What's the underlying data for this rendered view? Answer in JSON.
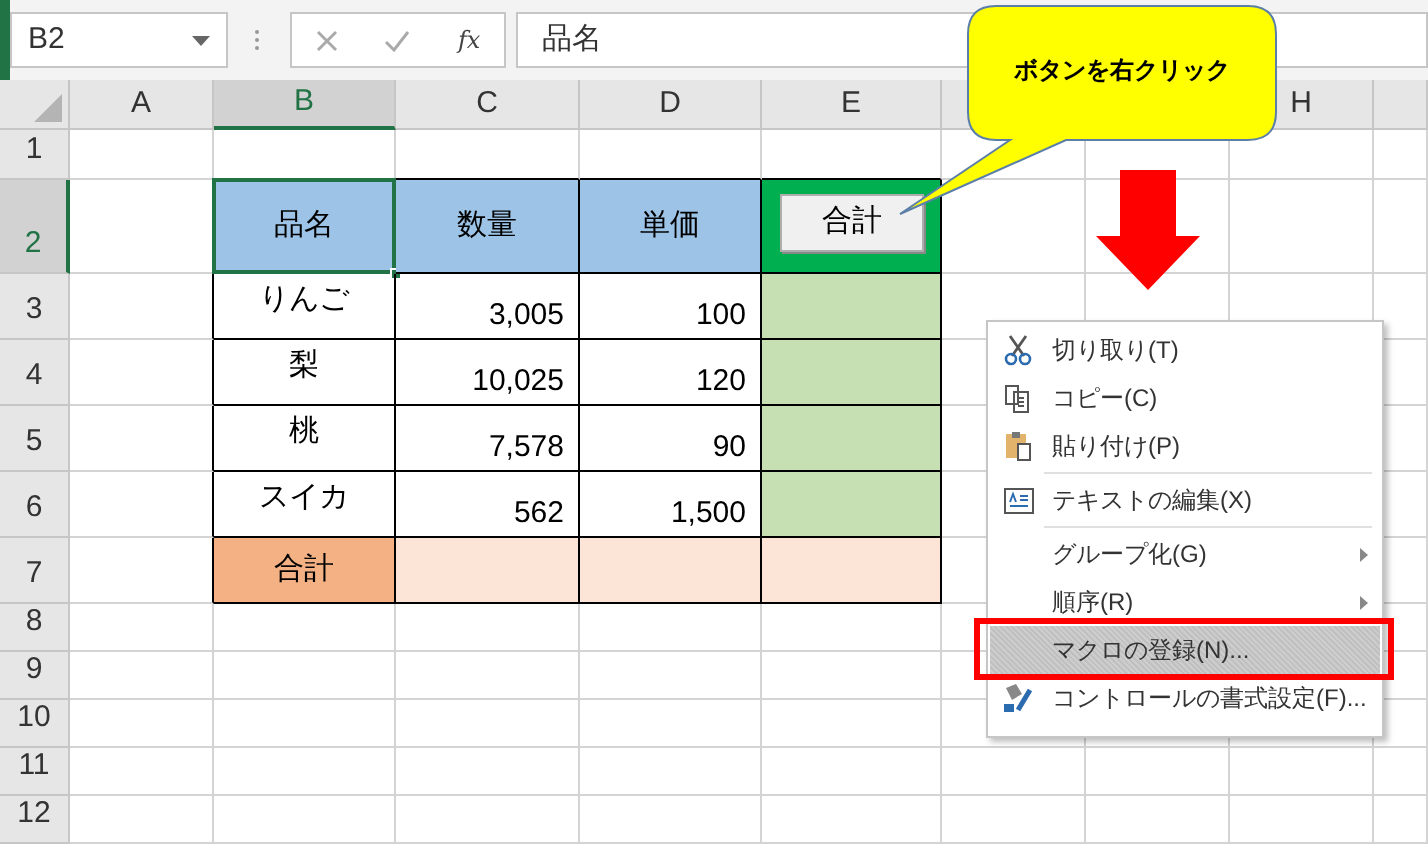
{
  "formula_bar": {
    "name_box": "B2",
    "function_label": "fx",
    "formula": "品名"
  },
  "columns": [
    {
      "label": "A",
      "selected": false
    },
    {
      "label": "B",
      "selected": true
    },
    {
      "label": "C",
      "selected": false
    },
    {
      "label": "D",
      "selected": false
    },
    {
      "label": "E",
      "selected": false
    },
    {
      "selected": false
    },
    {
      "label": "H",
      "selected": false
    }
  ],
  "rows": [
    {
      "label": "1",
      "selected": false
    },
    {
      "label": "2",
      "selected": true
    },
    {
      "label": "3",
      "selected": false
    },
    {
      "label": "4",
      "selected": false
    },
    {
      "label": "5",
      "selected": false
    },
    {
      "label": "6",
      "selected": false
    },
    {
      "label": "7",
      "selected": false
    },
    {
      "label": "8",
      "selected": false
    },
    {
      "label": "9",
      "selected": false
    },
    {
      "label": "10",
      "selected": false
    },
    {
      "label": "11",
      "selected": false
    },
    {
      "label": "12",
      "selected": false
    }
  ],
  "table": [
    {
      "kind": "header",
      "cells": [
        "品名",
        "数量",
        "単価"
      ]
    },
    {
      "kind": "data",
      "cells": [
        "りんご",
        "3,005",
        "100"
      ]
    },
    {
      "kind": "data",
      "cells": [
        "梨",
        "10,025",
        "120"
      ]
    },
    {
      "kind": "data",
      "cells": [
        "桃",
        "7,578",
        "90"
      ]
    },
    {
      "kind": "data",
      "cells": [
        "スイカ",
        "562",
        "1,500"
      ]
    },
    {
      "kind": "total",
      "cells": [
        "合計"
      ]
    }
  ],
  "sheet_button": {
    "label": "合計"
  },
  "callout": {
    "text": "ボタンを右クリック"
  },
  "context_menu": [
    {
      "label": "切り取り(T)",
      "kind": "cut",
      "submenu": false,
      "selected": false,
      "separator_before": false
    },
    {
      "label": "コピー(C)",
      "kind": "copy",
      "submenu": false,
      "selected": false,
      "separator_before": false
    },
    {
      "label": "貼り付け(P)",
      "kind": "paste",
      "submenu": false,
      "selected": false,
      "separator_before": false
    },
    {
      "label": "テキストの編集(X)",
      "kind": "edit",
      "submenu": false,
      "selected": false,
      "separator_before": true
    },
    {
      "label": "グループ化(G)",
      "kind": "plain",
      "submenu": true,
      "selected": false,
      "separator_before": true
    },
    {
      "label": "順序(R)",
      "kind": "plain",
      "submenu": true,
      "selected": false,
      "separator_before": false
    },
    {
      "label": "マクロの登録(N)...",
      "kind": "plain",
      "submenu": false,
      "selected": true,
      "separator_before": false
    },
    {
      "label": "コントロールの書式設定(F)...",
      "kind": "format",
      "submenu": false,
      "selected": false,
      "separator_before": false
    }
  ]
}
